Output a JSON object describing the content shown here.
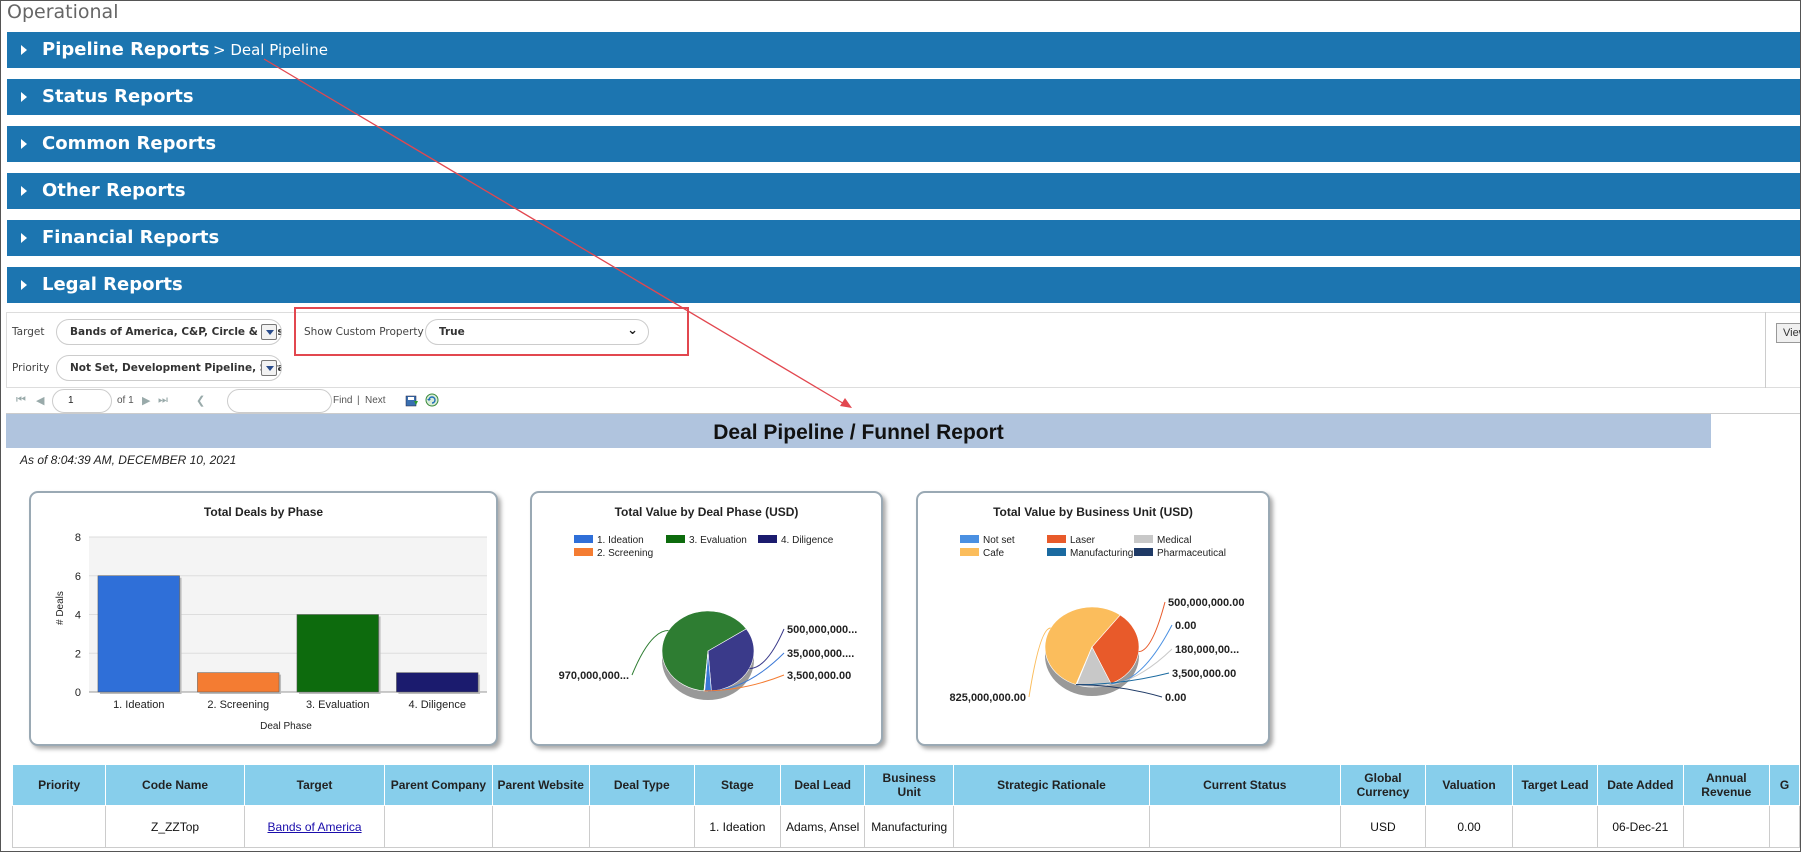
{
  "page_title": "Operational",
  "accordions": [
    {
      "label": "Pipeline Reports",
      "breadcrumb": "> Deal Pipeline"
    },
    {
      "label": "Status Reports"
    },
    {
      "label": "Common Reports"
    },
    {
      "label": "Other Reports"
    },
    {
      "label": "Financial Reports"
    },
    {
      "label": "Legal Reports"
    }
  ],
  "filters": {
    "target_label": "Target",
    "target_value": "Bands of America, C&P, Circle & Desser...",
    "priority_label": "Priority",
    "priority_value": "Not Set, Development Pipeline, Strategic...",
    "custom_property_label": "Show Custom Property",
    "custom_property_value": "True",
    "view_button": "View"
  },
  "toolbar": {
    "page_value": "1",
    "of_pages": "of 1",
    "find_placeholder": "",
    "find_label": "Find",
    "separator": "|",
    "next_label": "Next"
  },
  "report": {
    "title": "Deal Pipeline / Funnel Report",
    "as_of": "As of 8:04:39 AM, DECEMBER 10, 2021"
  },
  "chart_data": [
    {
      "type": "bar",
      "title": "Total Deals by Phase",
      "categories": [
        "1. Ideation",
        "2. Screening",
        "3. Evaluation",
        "4. Diligence"
      ],
      "values": [
        6,
        1,
        4,
        1
      ],
      "colors": [
        "#2f6fd8",
        "#f47c32",
        "#0d6b0d",
        "#1b1b6e"
      ],
      "xlabel": "Deal Phase",
      "ylabel": "# Deals",
      "ylim": [
        0,
        8
      ],
      "yticks": [
        "0",
        "2",
        "4",
        "6",
        "8"
      ]
    },
    {
      "type": "pie",
      "title": "Total Value by Deal Phase (USD)",
      "legend": [
        {
          "name": "1. Ideation",
          "color": "#2f6fd8"
        },
        {
          "name": "3. Evaluation",
          "color": "#0d6b0d"
        },
        {
          "name": "4. Diligence",
          "color": "#1b1b6e"
        },
        {
          "name": "2. Screening",
          "color": "#f47c32"
        }
      ],
      "slices": [
        {
          "name": "3. Evaluation",
          "value": 970000000,
          "label": "970,000,000...",
          "color": "#2e7d32"
        },
        {
          "name": "4. Diligence",
          "value": 500000000,
          "label": "500,000,000...",
          "color": "#3a3a8a"
        },
        {
          "name": "1. Ideation",
          "value": 35000000,
          "label": "35,000,000....",
          "color": "#3b78d6"
        },
        {
          "name": "2. Screening",
          "value": 3500000,
          "label": "3,500,000.00",
          "color": "#f47c32"
        }
      ]
    },
    {
      "type": "pie",
      "title": "Total Value by Business Unit (USD)",
      "legend": [
        {
          "name": "Not set",
          "color": "#4a90e2"
        },
        {
          "name": "Laser",
          "color": "#e85a2a"
        },
        {
          "name": "Medical",
          "color": "#c8c8c8"
        },
        {
          "name": "Cafe",
          "color": "#fbbd5c"
        },
        {
          "name": "Manufacturing",
          "color": "#1a6aa0"
        },
        {
          "name": "Pharmaceutical",
          "color": "#1f3a66"
        }
      ],
      "slices": [
        {
          "name": "Cafe",
          "value": 825000000,
          "label": "825,000,000.00",
          "color": "#fbbd5c"
        },
        {
          "name": "Laser",
          "value": 500000000,
          "label": "500,000,000.00",
          "color": "#e85a2a"
        },
        {
          "name": "Not set",
          "value": 0,
          "label": "0.00",
          "color": "#4a90e2"
        },
        {
          "name": "Medical",
          "value": 180000000,
          "label": "180,000,00...",
          "color": "#c8c8c8"
        },
        {
          "name": "Manufacturing",
          "value": 3500000,
          "label": "3,500,000.00",
          "color": "#1a6aa0"
        },
        {
          "name": "Pharmaceutical",
          "value": 0,
          "label": "0.00",
          "color": "#1f3a66"
        }
      ]
    }
  ],
  "table": {
    "headers": [
      "Priority",
      "Code Name",
      "Target",
      "Parent Company",
      "Parent Website",
      "Deal Type",
      "Stage",
      "Deal Lead",
      "Business Unit",
      "Strategic Rationale",
      "Current Status",
      "Global Currency",
      "Valuation",
      "Target Lead",
      "Date Added",
      "Annual Revenue",
      "G"
    ],
    "rows": [
      [
        "",
        "Z_ZZTop",
        "Bands of America",
        "",
        "",
        "",
        "1. Ideation",
        "Adams, Ansel",
        "Manufacturing",
        "",
        "",
        "USD",
        "0.00",
        "",
        "06-Dec-21",
        "",
        ""
      ]
    ]
  }
}
